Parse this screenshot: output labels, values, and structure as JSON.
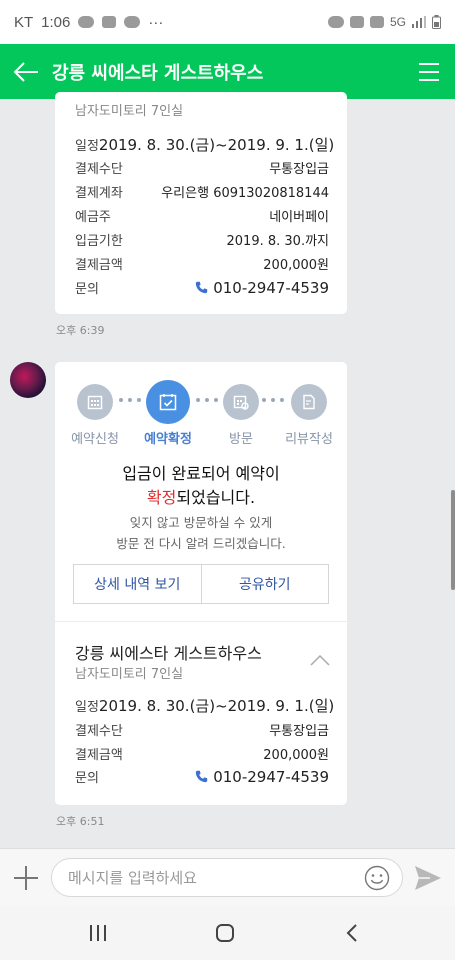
{
  "status_bar": {
    "carrier": "KT",
    "time": "1:06",
    "more": "···",
    "network": "5G"
  },
  "app_bar": {
    "title": "강릉 씨에스타 게스트하우스",
    "back_icon": "arrow-left-icon",
    "menu_icon": "hamburger-menu-icon"
  },
  "card1": {
    "subtitle": "남자도미토리 7인실",
    "rows": [
      {
        "label": "일정",
        "value": "2019. 8. 30.(금)~2019. 9. 1.(일)"
      },
      {
        "label": "결제수단",
        "value": "무통장입금"
      },
      {
        "label": "결제계좌",
        "value": "우리은행 60913020818144"
      },
      {
        "label": "예금주",
        "value": "네이버페이"
      },
      {
        "label": "입금기한",
        "value": "2019. 8. 30.까지"
      },
      {
        "label": "결제금액",
        "value": "200,000원"
      },
      {
        "label": "문의",
        "value": "010-2947-4539"
      }
    ],
    "time": "오후 6:39"
  },
  "card2": {
    "steps": [
      {
        "label": "예약신청",
        "icon": "calendar-grid-icon"
      },
      {
        "label": "예약확정",
        "icon": "calendar-check-icon"
      },
      {
        "label": "방문",
        "icon": "calendar-visit-icon"
      },
      {
        "label": "리뷰작성",
        "icon": "review-edit-icon"
      }
    ],
    "message_line1": "입금이 완료되어 예약이",
    "message_highlight": "확정",
    "message_line2_rest": "되었습니다.",
    "sub_line1": "잊지 않고 방문하실 수 있게",
    "sub_line2": "방문 전 다시 알려 드리겠습니다.",
    "btn_details": "상세 내역 보기",
    "btn_share": "공유하기",
    "title": "강릉 씨에스타 게스트하우스",
    "subtitle": "남자도미토리 7인실",
    "rows": [
      {
        "label": "일정",
        "value": "2019. 8. 30.(금)~2019. 9. 1.(일)"
      },
      {
        "label": "결제수단",
        "value": "무통장입금"
      },
      {
        "label": "결제금액",
        "value": "200,000원"
      },
      {
        "label": "문의",
        "value": "010-2947-4539"
      }
    ],
    "time": "오후 6:51"
  },
  "input_bar": {
    "placeholder": "메시지를 입력하세요"
  },
  "colors": {
    "brand": "#03c75a",
    "step_active": "#4a90e2",
    "step_inactive": "#b9c3d0",
    "highlight": "#e02f2f",
    "button_text": "#2f55a4"
  }
}
